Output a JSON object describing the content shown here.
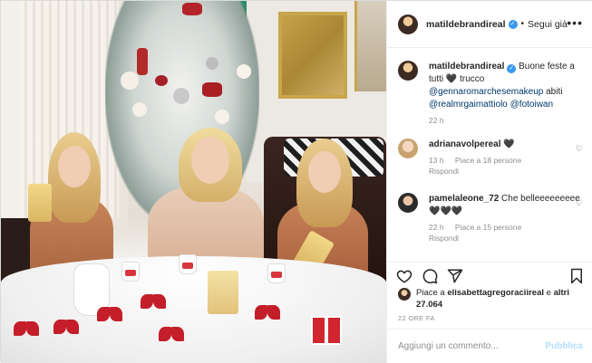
{
  "post": {
    "username": "matildebrandireal",
    "follow_label": "Segui già",
    "more_label": "•••"
  },
  "caption": {
    "username": "matildebrandireal",
    "text_start": "Buone feste a tutti",
    "text_heart": "🖤",
    "text_mid1": "trucco",
    "mention1": "@gennaromarchesemakeup",
    "text_mid2": "abiti",
    "mention2": "@realmrgaimattiolo",
    "mention3": "@fotoiwan",
    "time": "22 h"
  },
  "comments": [
    {
      "username": "adrianavolpereal",
      "text": "🖤",
      "time": "13 h",
      "likes": "Piace a 18 persone",
      "reply": "Rispondi"
    },
    {
      "username": "pamelaleone_72",
      "text": "Che belleeeeeeeee🖤🖤🖤",
      "time": "22 h",
      "likes": "Piace a 15 persone",
      "reply": "Rispondi"
    }
  ],
  "likes": {
    "text_start": "Piace a",
    "user": "elisabettagregoraciireal",
    "text_and": "e",
    "text_others": "altri 27.064"
  },
  "date": "22 ORE FA",
  "add_comment": {
    "placeholder": "Aggiungi un commento...",
    "publish_label": "Pubblica"
  },
  "icons": {
    "like": "heart-icon",
    "comment": "comment-icon",
    "share": "paper-plane-icon",
    "save": "bookmark-icon"
  }
}
